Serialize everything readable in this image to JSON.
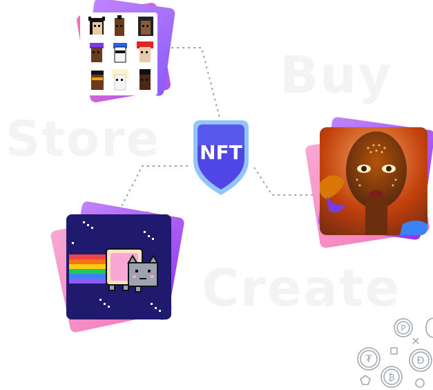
{
  "watermarks": {
    "buy": "Buy",
    "store": "Store",
    "create": "Create"
  },
  "badge": {
    "label": "NFT"
  },
  "colors": {
    "badge_outer": "#93c5fd",
    "badge_inner": "#4f46e5",
    "card_pink": "#f472b6",
    "card_purple": "#a855f7",
    "nyan_bg": "#1f1a6e",
    "connector": "#9ca3af"
  },
  "images": [
    {
      "name": "pixel-punks",
      "subject": "grid of 9 pixel-art punk avatars"
    },
    {
      "name": "portrait",
      "subject": "3D portrait of woman with glowing face patterns and butterfly"
    },
    {
      "name": "nyan-cat",
      "subject": "pixel cat with pop-tart body and rainbow trail"
    }
  ],
  "crypto_icons": [
    "tether-coin-icon",
    "dogecoin-coin-icon",
    "bitcoin-coin-icon",
    "ripple-coin-icon",
    "coin-icon"
  ]
}
